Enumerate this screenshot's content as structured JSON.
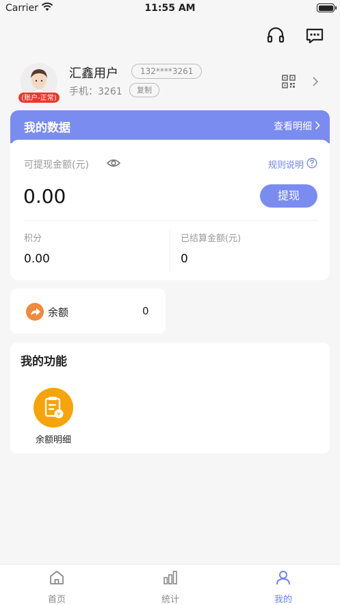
{
  "status_bar": {
    "carrier": "Carrier",
    "time": "11:55 AM"
  },
  "header": {
    "icons": [
      "headset-icon",
      "message-icon"
    ]
  },
  "profile": {
    "account_status": "(账户-正常)",
    "username": "汇鑫用户",
    "phone_masked": "132****3261",
    "phone_label": "手机：3261",
    "copy_label": "复制"
  },
  "my_data": {
    "title": "我的数据",
    "detail_link": "查看明细",
    "withdrawable_label": "可提现金额(元)",
    "rules_label": "规则说明",
    "withdrawable_amount": "0.00",
    "withdraw_button": "提现",
    "points_label": "积分",
    "points_value": "0.00",
    "settled_label": "已结算金额(元)",
    "settled_value": "0"
  },
  "balance": {
    "label": "余额",
    "value": "0"
  },
  "functions": {
    "title": "我的功能",
    "items": [
      {
        "label": "余额明细",
        "icon": "receipt-icon"
      }
    ]
  },
  "tabs": [
    {
      "label": "首页",
      "icon": "home-icon",
      "active": false
    },
    {
      "label": "统计",
      "icon": "stats-icon",
      "active": false
    },
    {
      "label": "我的",
      "icon": "user-icon",
      "active": true
    }
  ],
  "colors": {
    "accent": "#7b8cf0",
    "badge": "#e9382d",
    "func_icon": "#f7a40a",
    "balance_icon": "#f08a3c"
  }
}
